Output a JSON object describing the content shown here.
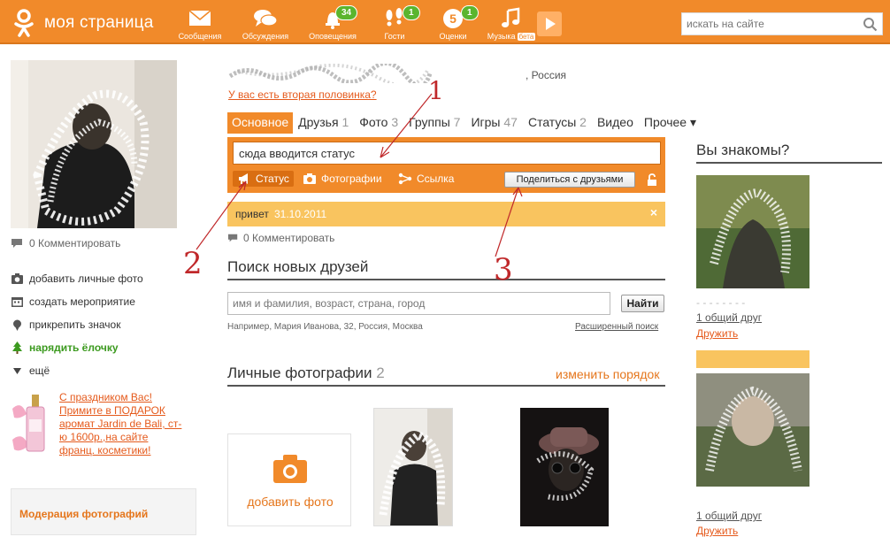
{
  "topbar": {
    "brand": "моя страница",
    "nav": [
      {
        "key": "messages",
        "label": "Сообщения",
        "icon": "envelope-icon",
        "badge": ""
      },
      {
        "key": "discussions",
        "label": "Обсуждения",
        "icon": "chat-bubbles-icon",
        "badge": ""
      },
      {
        "key": "notifications",
        "label": "Оповещения",
        "icon": "bell-icon",
        "badge": "34"
      },
      {
        "key": "guests",
        "label": "Гости",
        "icon": "footprints-icon",
        "badge": "1"
      },
      {
        "key": "ratings",
        "label": "Оценки",
        "icon": "five-rating-icon",
        "badge": "1"
      },
      {
        "key": "music",
        "label": "Музыка",
        "icon": "music-note-icon",
        "badge": "",
        "beta": "бета"
      }
    ],
    "search_placeholder": "искать на сайте"
  },
  "left": {
    "comment": "0 Комментировать",
    "links": [
      {
        "label": "добавить личные фото",
        "icon": "camera-icon"
      },
      {
        "label": "создать мероприятие",
        "icon": "calendar-icon"
      },
      {
        "label": "прикрепить значок",
        "icon": "pin-icon"
      },
      {
        "label": "нарядить ёлочку",
        "icon": "christmas-tree-icon"
      },
      {
        "label": "ещё",
        "icon": "triangle-down-icon"
      }
    ],
    "promo": "С праздником Вас! Примите в ПОДАРОК аромат Jardin de Bali, ст-ю 1600р.,на сайте франц. косметики!",
    "moderation": "Модерация фотографий"
  },
  "profile": {
    "country": ", Россия",
    "partner_link": "У вас есть вторая половинка?"
  },
  "tabs": [
    {
      "label": "Основное",
      "count": "",
      "active": true
    },
    {
      "label": "Друзья",
      "count": "1"
    },
    {
      "label": "Фото",
      "count": "3"
    },
    {
      "label": "Группы",
      "count": "7"
    },
    {
      "label": "Игры",
      "count": "47"
    },
    {
      "label": "Статусы",
      "count": "2"
    },
    {
      "label": "Видео",
      "count": ""
    },
    {
      "label": "Прочее ▾",
      "count": ""
    }
  ],
  "status": {
    "input_value": "сюда вводится статус",
    "btn_status": "Статус",
    "btn_photos": "Фотографии",
    "btn_link": "Ссылка",
    "share": "Поделиться с друзьями",
    "current_text": "привет",
    "current_date": "31.10.2011",
    "close": "×",
    "comment": "0 Комментировать"
  },
  "find_friends": {
    "title": "Поиск новых друзей",
    "placeholder": "имя и фамилия, возраст, страна, город",
    "button": "Найти",
    "example": "Например, Мария Иванова, 32, Россия, Москва",
    "advanced": "Расширенный поиск"
  },
  "photos": {
    "title": "Личные фотографии",
    "count": "2",
    "change_order": "изменить порядок",
    "add_photo": "добавить фото"
  },
  "right": {
    "title": "Вы знакомы?",
    "cards": [
      {
        "mutual": "1 общий друг",
        "action": "Дружить"
      },
      {
        "mutual": "1 общий друг",
        "action": "Дружить"
      }
    ]
  },
  "annotations": [
    "1",
    "2",
    "3"
  ],
  "colors": {
    "accent": "#f18a2a",
    "link": "#e55a1c",
    "status_strip": "#f9c45f",
    "annotation": "#c0282a"
  }
}
